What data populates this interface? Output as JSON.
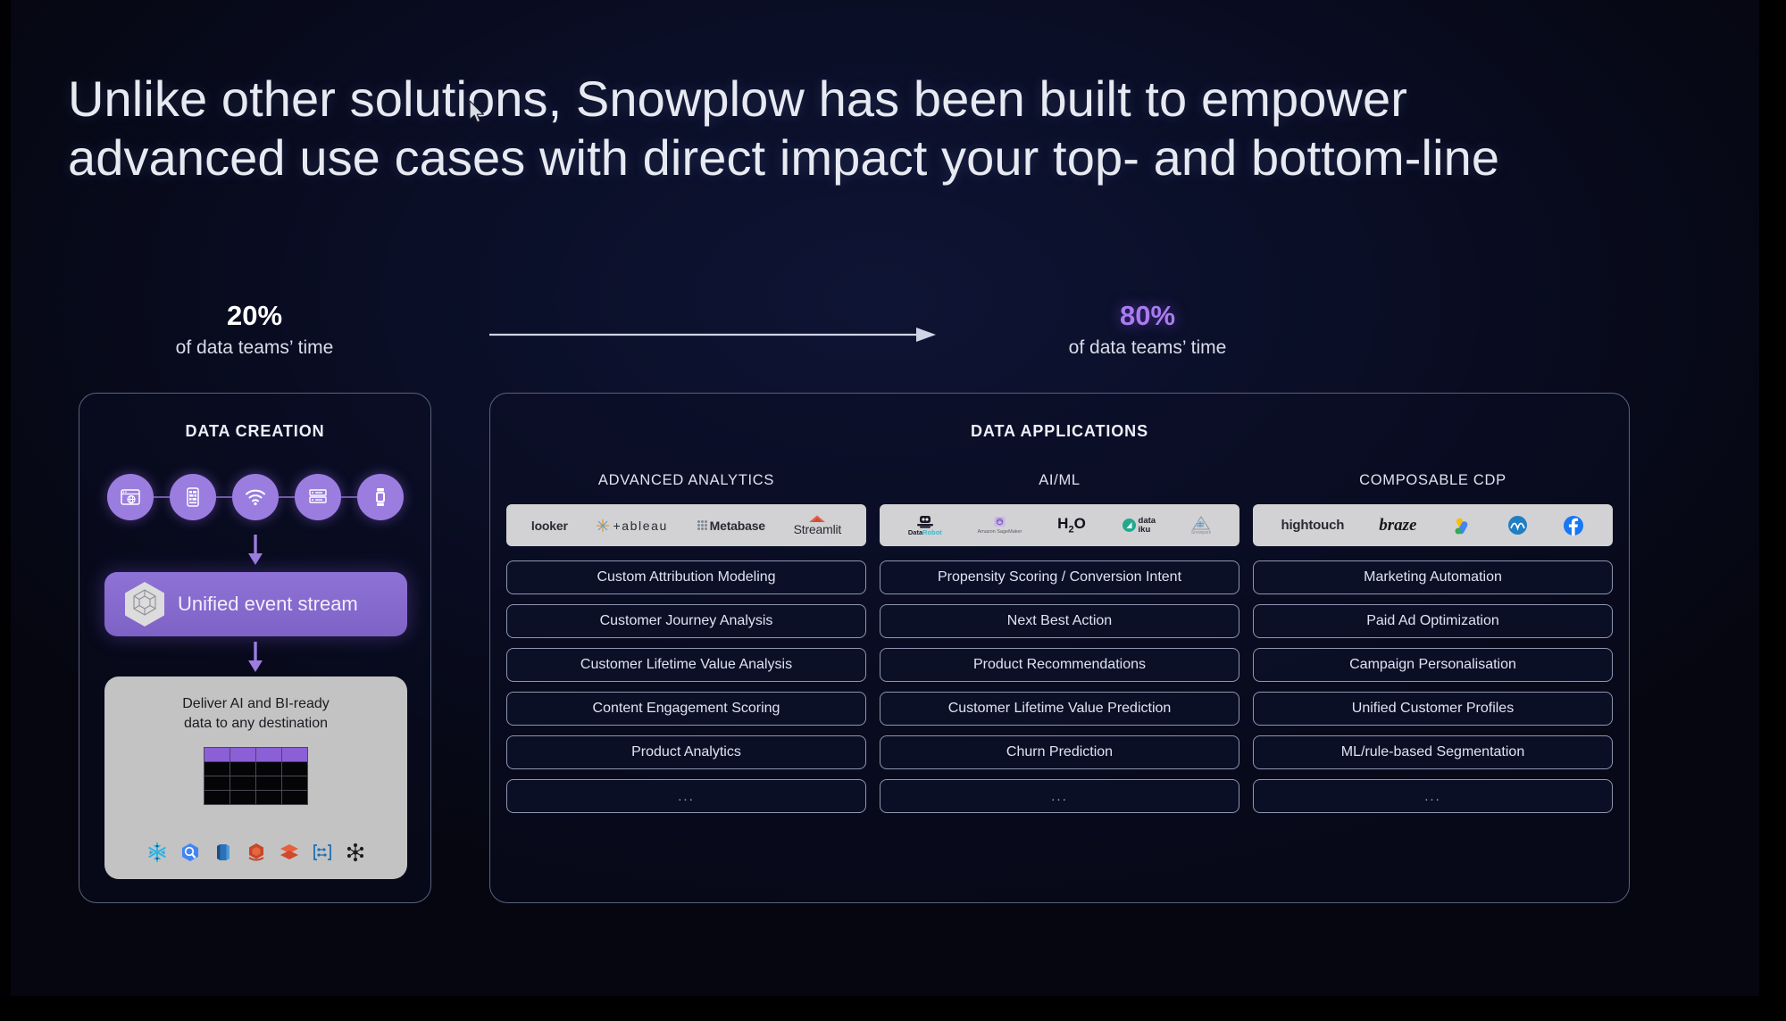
{
  "slide": {
    "title_line_1": "Unlike other solutions, Snowplow has been built to empower",
    "title_line_2": "advanced use cases with direct impact your top- and bottom-line"
  },
  "colors": {
    "background": "#0a0e26",
    "accent_purple": "#a97bf0",
    "stream_purple": "#8e72d6",
    "panel_border": "#5a627e",
    "text_primary": "#e8eaf2",
    "logo_strip_bg": "#d2d2d4",
    "destination_card_bg": "#c3c3c3"
  },
  "stats": {
    "left": {
      "value": "20%",
      "caption": "of data teams’ time"
    },
    "right": {
      "value": "80%",
      "caption": "of data teams’ time"
    },
    "arrow_icon": "right-arrow-icon"
  },
  "data_creation": {
    "title": "DATA CREATION",
    "sources": [
      {
        "name": "web-browser-icon",
        "label": "Web"
      },
      {
        "name": "mobile-app-icon",
        "label": "Mobile"
      },
      {
        "name": "wifi-iot-icon",
        "label": "IoT"
      },
      {
        "name": "server-icon",
        "label": "Server"
      },
      {
        "name": "smartwatch-icon",
        "label": "Wearable"
      }
    ],
    "stream": {
      "label": "Unified event stream",
      "icon": "snowplow-hexagon-icon"
    },
    "flow_arrow_icon": "down-arrow-icon",
    "destination": {
      "text_line_1": "Deliver  AI and BI-ready",
      "text_line_2": "data to any destination",
      "table_icon": "data-table-icon",
      "logos": [
        "snowflake-logo",
        "google-bigquery-logo",
        "aws-redshift-logo",
        "aws-logo",
        "databricks-logo",
        "azure-synapse-logo",
        "kubernetes-logo"
      ]
    }
  },
  "data_applications": {
    "title": "DATA APPLICATIONS",
    "columns": [
      {
        "header": "ADVANCED ANALYTICS",
        "logos": [
          {
            "name": "looker-logo",
            "text": "looker"
          },
          {
            "name": "tableau-logo",
            "text": "+ableau"
          },
          {
            "name": "metabase-logo",
            "text": "Metabase"
          },
          {
            "name": "streamlit-logo",
            "text": "Streamlit"
          }
        ],
        "use_cases": [
          "Custom Attribution Modeling",
          "Customer Journey Analysis",
          "Customer Lifetime Value Analysis",
          "Content Engagement Scoring",
          "Product Analytics",
          "..."
        ]
      },
      {
        "header": "AI/ML",
        "logos": [
          {
            "name": "datarobot-logo",
            "text": "DataRobot"
          },
          {
            "name": "amazon-sagemaker-logo",
            "text": "Amazon SageMaker"
          },
          {
            "name": "h2o-logo",
            "text": "H₂O"
          },
          {
            "name": "dataiku-logo",
            "text": "data iku"
          },
          {
            "name": "snowpark-logo",
            "text": "Snowpark"
          }
        ],
        "use_cases": [
          "Propensity Scoring / Conversion Intent",
          "Next Best Action",
          "Product Recommendations",
          "Customer Lifetime Value Prediction",
          "Churn Prediction",
          "..."
        ]
      },
      {
        "header": "COMPOSABLE CDP",
        "logos": [
          {
            "name": "hightouch-logo",
            "text": "hightouch"
          },
          {
            "name": "braze-logo",
            "text": "braze"
          },
          {
            "name": "google-ads-logo",
            "text": "Google Ads"
          },
          {
            "name": "amplitude-logo",
            "text": "Amplitude"
          },
          {
            "name": "facebook-logo",
            "text": "Facebook"
          }
        ],
        "use_cases": [
          "Marketing Automation",
          "Paid Ad Optimization",
          "Campaign Personalisation",
          "Unified Customer Profiles",
          "ML/rule-based Segmentation",
          "..."
        ]
      }
    ]
  }
}
